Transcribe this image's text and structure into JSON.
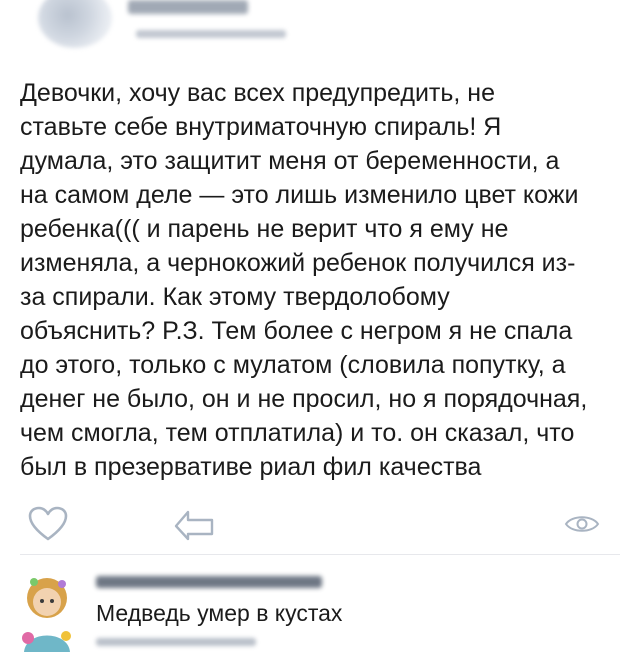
{
  "post": {
    "text": "Девочки, хочу вас всех предупредить, не\nставьте себе внутриматочную спираль! Я\nдумала, это защитит меня от беременности, а\nна самом деле — это лишь изменило цвет кожи\nребенка((( и парень не верит что я ему не\nизменяла, а чернокожий ребенок получился из-\nза спирали. Как этому твердолобому\nобъяснить? P.З. Тем более с негром я не спала\nдо этого, только с мулатом (словила попутку, а\nденег не было, он и не просил, но я порядочная,\nчем смогла, тем отплатила) и то. он сказал, что\nбыл в презервативе риал фил качества"
  },
  "actions": {
    "like_icon": "heart-icon",
    "share_icon": "share-icon",
    "views_icon": "eye-icon"
  },
  "comment": {
    "text": "Медведь умер в кустах"
  },
  "colors": {
    "icon": "#a9b4c2",
    "text": "#1b1b1b",
    "divider": "#e7e8ec"
  }
}
